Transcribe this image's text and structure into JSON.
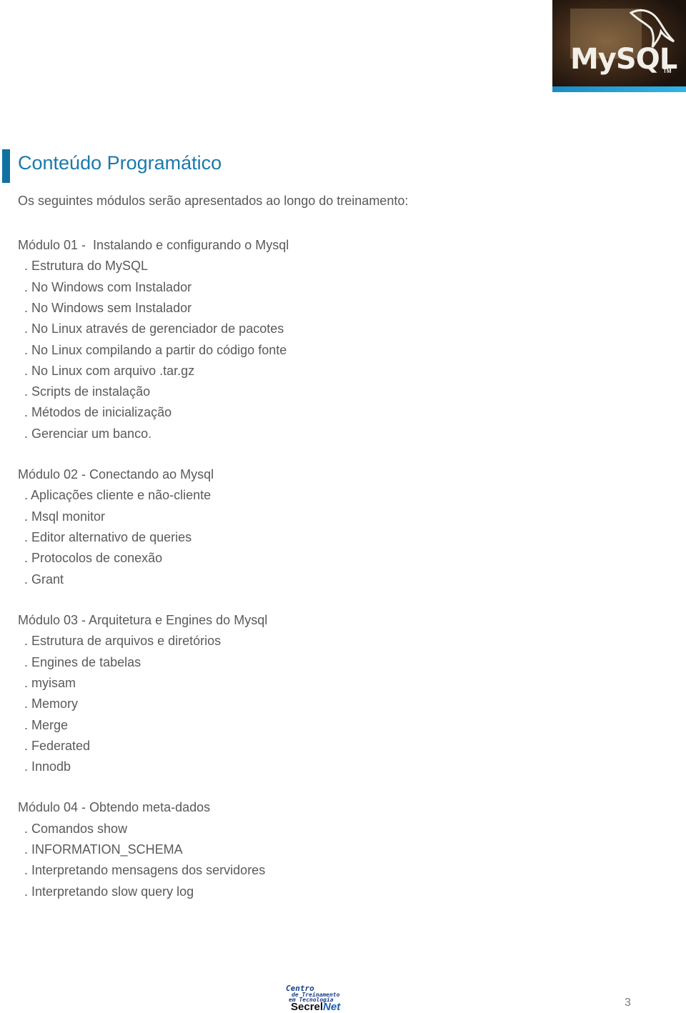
{
  "header": {
    "logo_text": "MySQL",
    "logo_tm": "TM",
    "accent_color": "#0e71a2"
  },
  "title": "Conteúdo Programático",
  "intro": "Os seguintes módulos serão apresentados ao longo do treinamento:",
  "modules": [
    {
      "title": "Módulo 01 -  Instalando e configurando o Mysql",
      "topics": [
        ". Estrutura do MySQL",
        ". No Windows com Instalador",
        ". No Windows sem Instalador",
        ". No Linux através de gerenciador de pacotes",
        ". No Linux compilando a partir do código fonte",
        ". No Linux com arquivo .tar.gz",
        ". Scripts de instalação",
        ". Métodos de inicialização",
        ". Gerenciar um banco."
      ]
    },
    {
      "title": "Módulo 02 - Conectando ao Mysql",
      "topics": [
        ". Aplicações cliente e não-cliente",
        ". Msql monitor",
        ". Editor alternativo de queries",
        ". Protocolos de conexão",
        ". Grant"
      ]
    },
    {
      "title": "Módulo 03 - Arquitetura e Engines do Mysql",
      "topics": [
        ". Estrutura de arquivos e diretórios",
        ". Engines de tabelas",
        ". myisam",
        ". Memory",
        ". Merge",
        ". Federated",
        ". Innodb"
      ]
    },
    {
      "title": "Módulo 04 - Obtendo meta-dados",
      "topics": [
        ". Comandos show",
        ". INFORMATION_SCHEMA",
        ". Interpretando mensagens dos servidores",
        ". Interpretando slow query log"
      ]
    }
  ],
  "footer": {
    "logo_line1": "Centro",
    "logo_line2": "de Treinamento",
    "logo_line3": "em Tecnologia",
    "logo_brand_a": "Secrel",
    "logo_brand_b": "Net",
    "page_number": "3"
  }
}
